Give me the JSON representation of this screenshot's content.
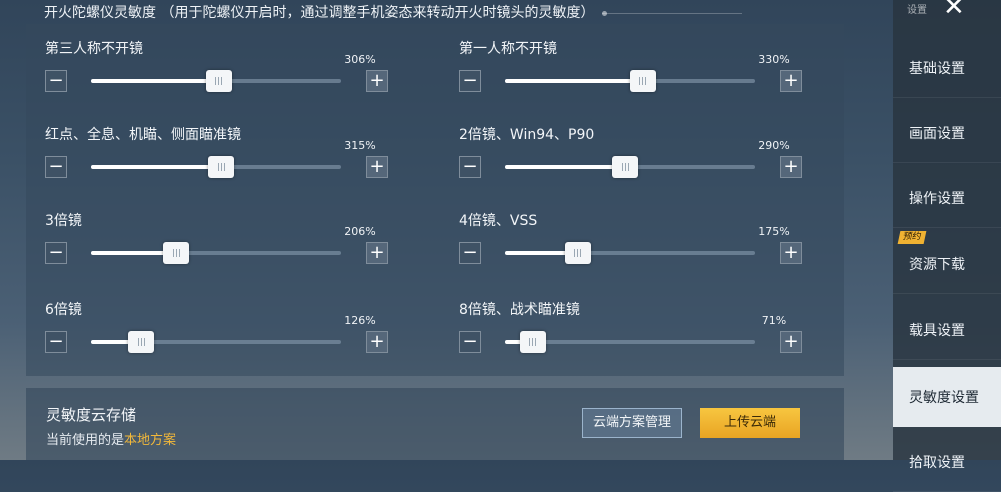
{
  "header": {
    "title": "开火陀螺仪灵敏度 （用于陀螺仪开启时，通过调整手机姿态来转动开火时镜头的灵敏度）"
  },
  "sliders": [
    {
      "label": "第三人称不开镜",
      "percent_text": "306%",
      "value": 0.51
    },
    {
      "label": "第一人称不开镜",
      "percent_text": "330%",
      "value": 0.55
    },
    {
      "label": "红点、全息、机瞄、侧面瞄准镜",
      "percent_text": "315%",
      "value": 0.52
    },
    {
      "label": "2倍镜、Win94、P90",
      "percent_text": "290%",
      "value": 0.48
    },
    {
      "label": "3倍镜",
      "percent_text": "206%",
      "value": 0.34
    },
    {
      "label": "4倍镜、VSS",
      "percent_text": "175%",
      "value": 0.29
    },
    {
      "label": "6倍镜",
      "percent_text": "126%",
      "value": 0.2
    },
    {
      "label": "8倍镜、战术瞄准镜",
      "percent_text": "71%",
      "value": 0.11
    }
  ],
  "controls": {
    "minus": "−",
    "plus": "+"
  },
  "cloud": {
    "title": "灵敏度云存储",
    "current_prefix": "当前使用的是",
    "current_value": "本地方案",
    "manage_button": "云端方案管理",
    "upload_button": "上传云端"
  },
  "sidebar": {
    "top_text": "设置",
    "close_glyph": "✕",
    "items": [
      {
        "label": "基础设置"
      },
      {
        "label": "画面设置"
      },
      {
        "label": "操作设置"
      },
      {
        "label": "资源下载",
        "badge": "预约"
      },
      {
        "label": "载具设置"
      },
      {
        "label": "灵敏度设置",
        "active": true
      },
      {
        "label": "拾取设置"
      }
    ]
  },
  "colors": {
    "accent": "#f2b83a",
    "upload_button": "#f4b93a"
  }
}
